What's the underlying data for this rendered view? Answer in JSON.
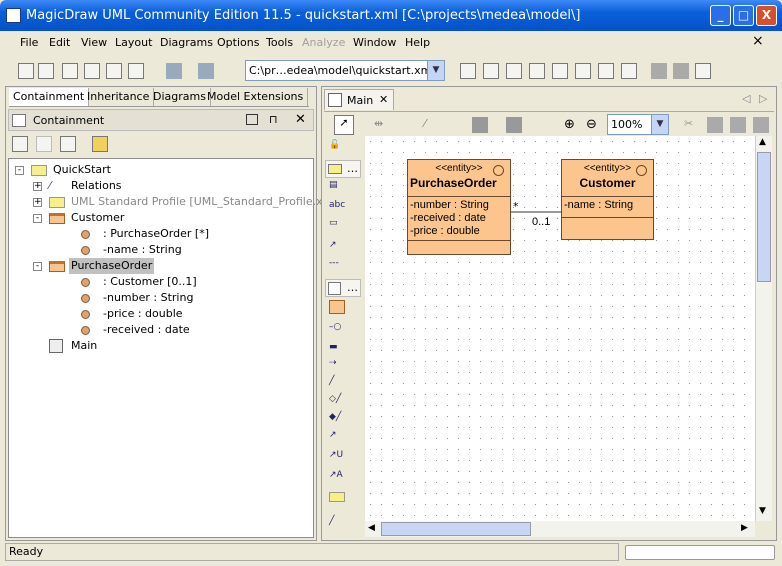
{
  "window": {
    "title": "MagicDraw UML Community Edition 11.5 - quickstart.xml [C:\\projects\\medea\\model\\]",
    "minimize": "_",
    "maximize": "□",
    "close": "X"
  },
  "menu": {
    "items": [
      {
        "label": "File",
        "enabled": true
      },
      {
        "label": "Edit",
        "enabled": true
      },
      {
        "label": "View",
        "enabled": true
      },
      {
        "label": "Layout",
        "enabled": true
      },
      {
        "label": "Diagrams",
        "enabled": true
      },
      {
        "label": "Options",
        "enabled": true
      },
      {
        "label": "Tools",
        "enabled": true
      },
      {
        "label": "Analyze",
        "enabled": false
      },
      {
        "label": "Window",
        "enabled": true
      },
      {
        "label": "Help",
        "enabled": true
      }
    ],
    "close": "×"
  },
  "toolbar": {
    "project_path": "C:\\pr…edea\\model\\quickstart.xml",
    "icons": [
      "new-icon",
      "open-icon",
      "save-icon",
      "print-preview-icon",
      "print-icon",
      "find-icon",
      "undo-icon",
      "redo-icon"
    ],
    "diagram_icons": [
      "class-diagram-icon",
      "use-case-diagram-icon",
      "component-diagram-icon",
      "sequence-diagram-icon",
      "state-diagram-icon",
      "activity-diagram-icon",
      "collaboration-diagram-icon",
      "deployment-diagram-icon"
    ]
  },
  "left_panel": {
    "tabs": [
      "Containment",
      "Inheritance",
      "Diagrams",
      "Model Extensions"
    ],
    "header": "Containment",
    "tree": [
      {
        "label": "QuickStart",
        "level": 0,
        "icon": "model-icon",
        "expander": "-"
      },
      {
        "label": "Relations",
        "level": 1,
        "icon": "relations-icon",
        "expander": "+"
      },
      {
        "label": "UML Standard Profile [UML_Standard_Profile.xml]",
        "level": 1,
        "icon": "profile-folder-icon",
        "expander": "+",
        "greyed": true
      },
      {
        "label": "Customer",
        "level": 1,
        "icon": "class-icon",
        "expander": "-"
      },
      {
        "label": " : PurchaseOrder [*]",
        "level": 2,
        "icon": "attribute-icon"
      },
      {
        "label": "-name : String",
        "level": 2,
        "icon": "attribute-icon"
      },
      {
        "label": "PurchaseOrder",
        "level": 1,
        "icon": "class-icon",
        "expander": "-",
        "selected": true
      },
      {
        "label": " : Customer [0..1]",
        "level": 2,
        "icon": "attribute-icon"
      },
      {
        "label": "-number : String",
        "level": 2,
        "icon": "attribute-icon"
      },
      {
        "label": "-price : double",
        "level": 2,
        "icon": "attribute-icon"
      },
      {
        "label": "-received : date",
        "level": 2,
        "icon": "attribute-icon"
      },
      {
        "label": "Main",
        "level": 1,
        "icon": "diagram-icon"
      }
    ]
  },
  "diagram": {
    "tab": "Main",
    "zoom": "100%",
    "palette_more": "…",
    "classes": [
      {
        "stereotype": "<<entity>>",
        "name": "PurchaseOrder",
        "attributes": [
          "-number : String",
          "-received : date",
          "-price : double"
        ]
      },
      {
        "stereotype": "<<entity>>",
        "name": "Customer",
        "attributes": [
          "-name : String"
        ]
      }
    ],
    "association": {
      "source_multiplicity": "*",
      "target_multiplicity": "0..1"
    }
  },
  "status": {
    "text": "Ready"
  },
  "colors": {
    "class_fill": "#fdc58e",
    "title_bar": "#0a5fd8",
    "selection": "#c0c0c0"
  }
}
